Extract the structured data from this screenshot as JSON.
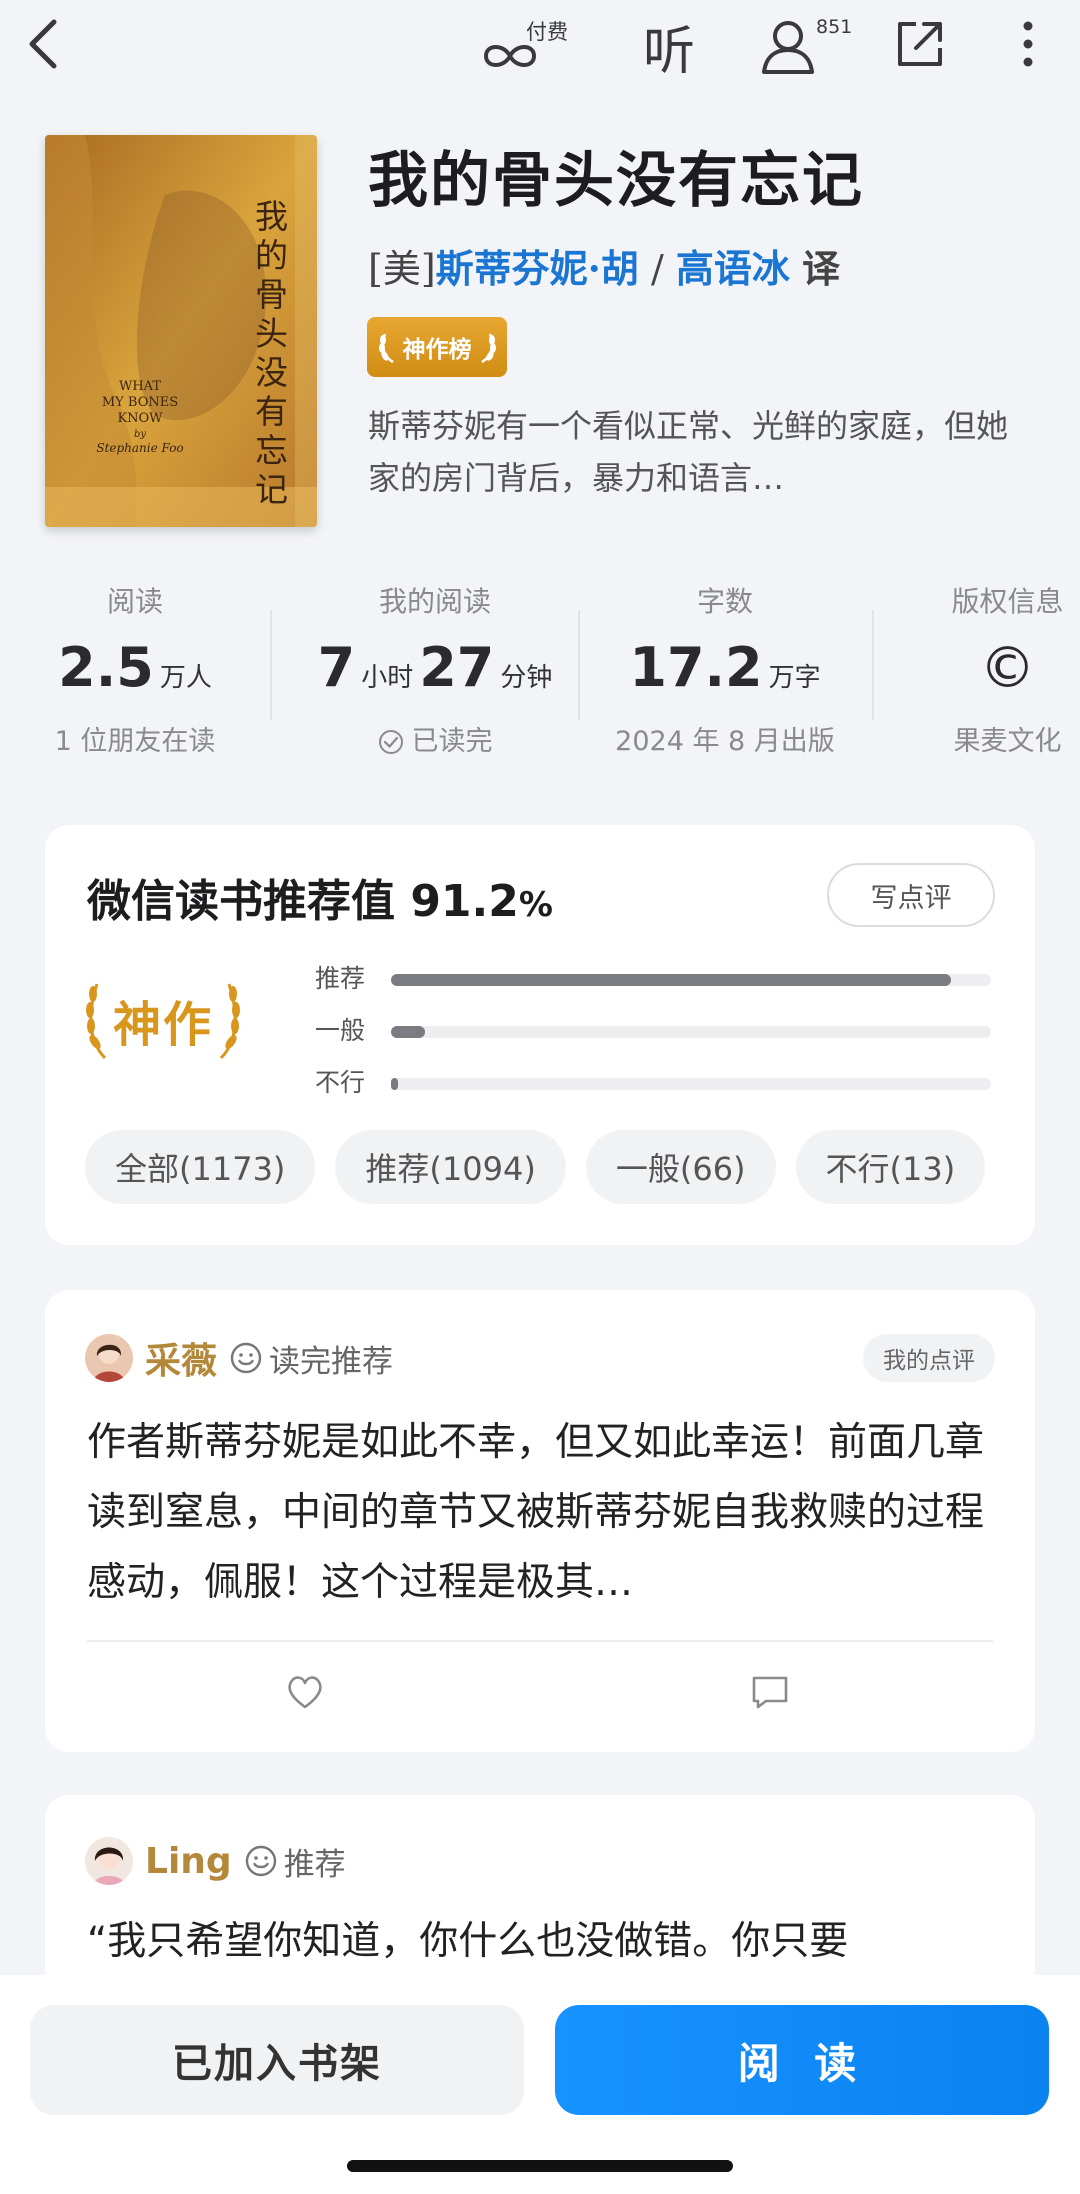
{
  "topbar": {
    "paid_label": "付费",
    "listen_label": "听",
    "user_count": "851"
  },
  "book": {
    "title": "我的骨头没有忘记",
    "author_prefix": "[美]",
    "author": "斯蒂芬妮·胡",
    "separator": "/",
    "translator": "高语冰",
    "translator_suffix": "译",
    "badge": "神作榜",
    "description": "斯蒂芬妮有一个看似正常、光鲜的家庭，但她家的房门背后，暴力和语言…",
    "cover": {
      "title_cn": "我的骨头没有忘记",
      "title_en_1": "WHAT",
      "title_en_2": "MY BONES",
      "title_en_3": "KNOW",
      "by": "by",
      "author_en": "Stephanie Foo",
      "colors": [
        "#b9802b",
        "#d9a43c",
        "#6b3b1c"
      ]
    }
  },
  "stats": {
    "reads": {
      "label": "阅读",
      "value": "2.5",
      "unit": "万人",
      "sub": "1 位朋友在读"
    },
    "my_reading": {
      "label": "我的阅读",
      "hours": "7",
      "hours_unit": "小时",
      "minutes": "27",
      "minutes_unit": "分钟",
      "sub": "已读完"
    },
    "words": {
      "label": "字数",
      "value": "17.2",
      "unit": "万字",
      "sub": "2024 年 8 月出版"
    },
    "copyright": {
      "label": "版权信息",
      "symbol": "©",
      "sub": "果麦文化"
    }
  },
  "recommend": {
    "title": "微信读书推荐值 91.2",
    "percent_sign": "%",
    "write_button": "写点评",
    "emblem": "神作",
    "bars": [
      {
        "label": "推荐",
        "fraction": 0.933
      },
      {
        "label": "一般",
        "fraction": 0.056
      },
      {
        "label": "不行",
        "fraction": 0.011
      }
    ],
    "filters": [
      "全部(1173)",
      "推荐(1094)",
      "一般(66)",
      "不行(13)"
    ]
  },
  "reviews": [
    {
      "name": "采薇",
      "tag": "读完推荐",
      "my_review": "我的点评",
      "text": "作者斯蒂芬妮是如此不幸，但又如此幸运！前面几章读到窒息，中间的章节又被斯蒂芬妮自我救赎的过程感动，佩服！这个过程是极其…"
    },
    {
      "name": "Ling",
      "tag": "推荐",
      "text": "“我只希望你知道，你什么也没做错。你只要"
    }
  ],
  "bottom": {
    "shelf_button": "已加入书架",
    "read_button": "阅 读"
  },
  "colors": {
    "accent_blue": "#1a76d2",
    "gold": "#d9961d",
    "read_button": "#0a82f0"
  }
}
